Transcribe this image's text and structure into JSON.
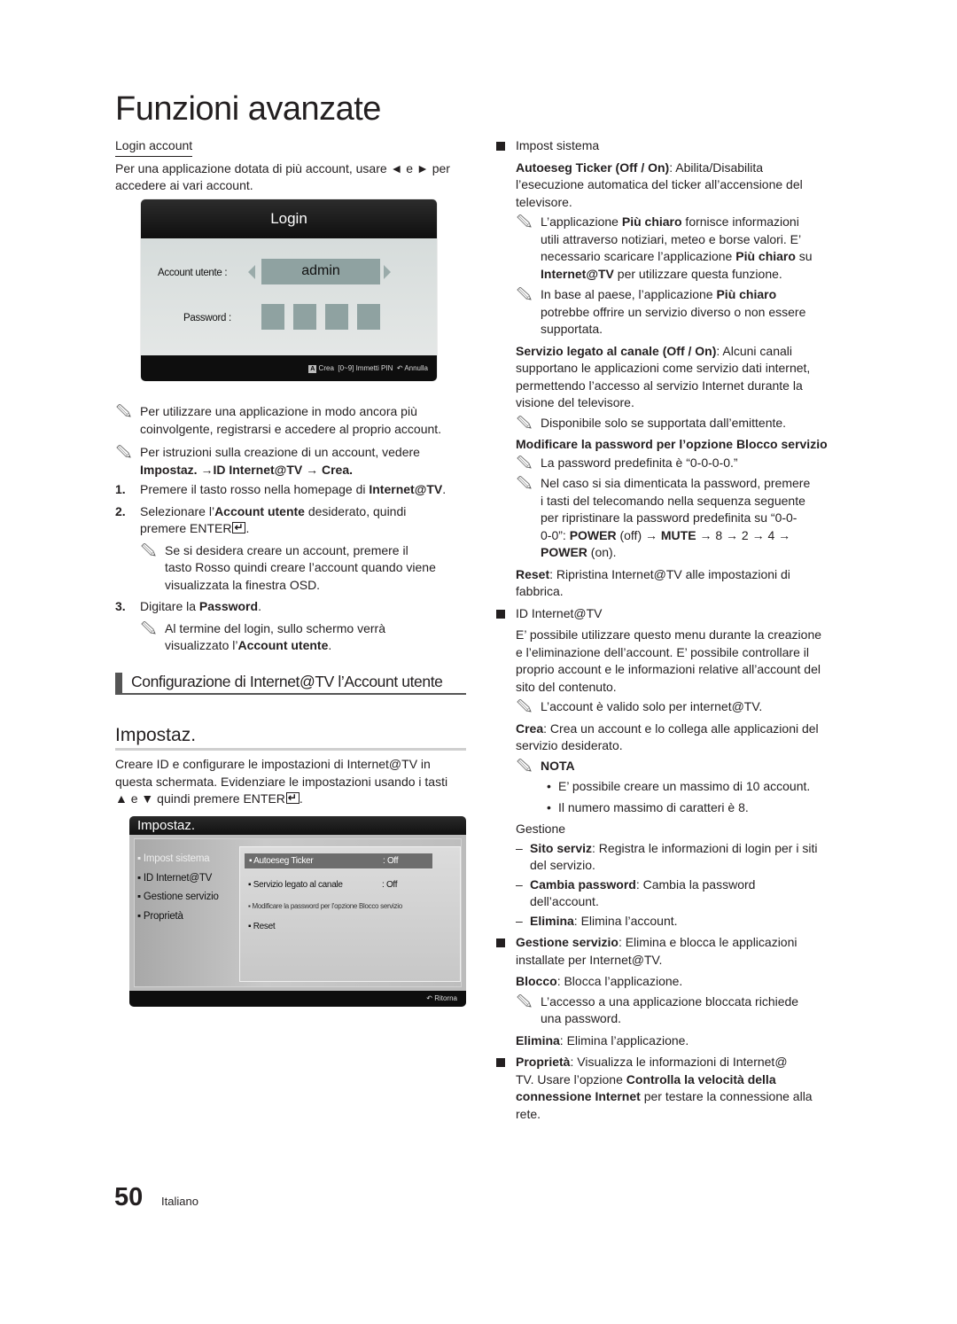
{
  "page": {
    "title": "Funzioni avanzate",
    "page_number": "50",
    "language": "Italiano"
  },
  "left": {
    "login_account": {
      "heading": "Login account",
      "intro_a": "Per una applicazione dotata di più account, usare ◄ e ► per",
      "intro_b": "accedere ai vari account."
    },
    "login_osd": {
      "title": "Login",
      "account_label": "Account utente :",
      "account_value": "admin",
      "password_label": "Password :",
      "footer_key": "A",
      "footer_create": "Crea",
      "footer_pin": "[0~9] Immetti PIN",
      "footer_return_icon": "return-icon",
      "footer_cancel": "Annulla"
    },
    "note1_a": "Per utilizzare una applicazione in modo ancora più",
    "note1_b": "coinvolgente, registrarsi e accedere al proprio account.",
    "note2_a": "Per istruzioni sulla creazione di un account, vedere",
    "note2_b": "Impostaz. →ID Internet@TV → Crea.",
    "steps": [
      {
        "num": "1.",
        "pre": "Premere il tasto rosso nella homepage di ",
        "bold": "Internet@TV",
        "post": "."
      },
      {
        "num": "2.",
        "pre": "Selezionare l’",
        "bold": "Account utente",
        "post": " desiderato, quindi",
        "line2": "premere ENTER"
      },
      {
        "num": "3.",
        "pre": "Digitare la ",
        "bold": "Password",
        "post": "."
      }
    ],
    "step2_note_a": "Se si desidera creare un account, premere il",
    "step2_note_b": "tasto Rosso quindi creare l’account quando viene",
    "step2_note_c": "visualizzata la finestra OSD.",
    "step3_note_a": "Al termine del login, sullo schermo verrà",
    "step3_note_b_pre": "visualizzato l’",
    "step3_note_b_bold": "Account utente",
    "step3_note_b_post": ".",
    "config_heading": "Configurazione di Internet@TV l’Account utente",
    "impostaz_heading": "Impostaz.",
    "impostaz_desc_a": "Creare ID e configurare le impostazioni di Internet@TV in",
    "impostaz_desc_b": "questa schermata. Evidenziare le impostazioni usando i tasti",
    "impostaz_desc_c": "▲ e ▼ quindi premere ENTER",
    "impostaz_osd": {
      "title": "Impostaz.",
      "menu": [
        "Impost sistema",
        "ID Internet@TV",
        "Gestione servizio",
        "Proprietà"
      ],
      "selected_menu": "Impost sistema",
      "rows": [
        {
          "label": "Autoeseg Ticker",
          "value": ": Off",
          "highlighted": true
        },
        {
          "label": "Servizio legato al canale",
          "value": ": Off"
        },
        {
          "label": "Modificare la password per l’opzione Blocco servizio",
          "value": ""
        },
        {
          "label": "Reset",
          "value": ""
        }
      ],
      "footer_return": "Ritorna"
    }
  },
  "right": {
    "impost_sistema": {
      "heading": "Impost sistema",
      "ticker_bold": "Autoeseg Ticker (Off / On)",
      "ticker_text_a": ": Abilita/Disabilita",
      "ticker_text_b": "l’esecuzione automatica del ticker all’accensione del",
      "ticker_text_c": "televisore.",
      "note1_a_pre": "L’applicazione ",
      "note1_a_bold": "Più chiaro",
      "note1_a_post": " fornisce informazioni",
      "note1_b": "utili attraverso notiziari, meteo e borse valori. E’",
      "note1_c_pre": "necessario scaricare l’applicazione ",
      "note1_c_bold": "Più chiaro",
      "note1_c_post": " su",
      "note1_d_bold": "Internet@TV",
      "note1_d_post": " per utilizzare questa funzione.",
      "note2_a_pre": "In base al paese, l’applicazione ",
      "note2_a_bold": "Più chiaro",
      "note2_b": "potrebbe offrire un servizio diverso o non essere",
      "note2_c": "supportata.",
      "servizio_bold": "Servizio legato al canale (Off / On)",
      "servizio_a": ": Alcuni canali",
      "servizio_b": "supportano le applicazioni come servizio dati internet,",
      "servizio_c": "permettendo l’accesso al servizio Internet durante la",
      "servizio_d": "visione del televisore.",
      "servizio_note": "Disponibile solo se supportata dall’emittente.",
      "pwd_heading": "Modificare la password per l’opzione Blocco servizio",
      "pwd_note1": "La password predefinita è “0-0-0-0.”",
      "pwd_note2_a": "Nel caso si sia dimenticata la password, premere",
      "pwd_note2_b": "i tasti del telecomando nella sequenza seguente",
      "pwd_note2_c": "per ripristinare la password predefinita su “0-0-",
      "pwd_note2_d_pre": "0-0”: ",
      "pwd_note2_d_b1": "POWER",
      "pwd_note2_d_mid": " (off) → ",
      "pwd_note2_d_b2": "MUTE",
      "pwd_note2_d_post": " → 8 → 2 → 4 →",
      "pwd_note2_e_bold": "POWER",
      "pwd_note2_e_post": " (on).",
      "reset_bold": "Reset",
      "reset_a": ": Ripristina Internet@TV alle impostazioni di",
      "reset_b": "fabbrica."
    },
    "id_internet": {
      "heading": "ID Internet@TV",
      "text_a": "E’ possibile utilizzare questo menu durante la creazione",
      "text_b": "e l’eliminazione dell’account. E’ possibile controllare il",
      "text_c": "proprio account e le informazioni relative all’account del",
      "text_d": "sito del contenuto.",
      "note": "L’account è valido solo per internet@TV.",
      "crea_bold": "Crea",
      "crea_a": ": Crea un account e lo collega alle applicazioni del",
      "crea_b": "servizio desiderato.",
      "nota_label": "NOTA",
      "nota_items": [
        "E’ possibile creare un massimo di 10 account.",
        "Il numero massimo di caratteri è 8."
      ],
      "gestione_heading": "Gestione",
      "gestione_items": [
        {
          "bold": "Sito serviz",
          "text": ": Registra le informazioni di login per i siti",
          "line2": "del servizio."
        },
        {
          "bold": "Cambia password",
          "text": ": Cambia la password",
          "line2": "dell’account."
        },
        {
          "bold": "Elimina",
          "text": ": Elimina l’account.",
          "line2": ""
        }
      ]
    },
    "gestione_servizio": {
      "bold": "Gestione servizio",
      "text_a": ": Elimina e blocca le applicazioni",
      "text_b": "installate per Internet@TV.",
      "blocco_bold": "Blocco",
      "blocco_text": ": Blocca l’applicazione.",
      "blocco_note_a": "L’accesso a una applicazione bloccata richiede",
      "blocco_note_b": "una password.",
      "elimina_bold": "Elimina",
      "elimina_text": ": Elimina l’applicazione."
    },
    "proprieta": {
      "bold": "Proprietà",
      "text_a": ": Visualizza le informazioni di Internet@",
      "text_b_pre": "TV. Usare l’opzione ",
      "text_b_bold": "Controlla la velocità della",
      "text_c_bold": "connessione Internet",
      "text_c_post": " per testare la connessione alla",
      "text_d": "rete."
    }
  }
}
